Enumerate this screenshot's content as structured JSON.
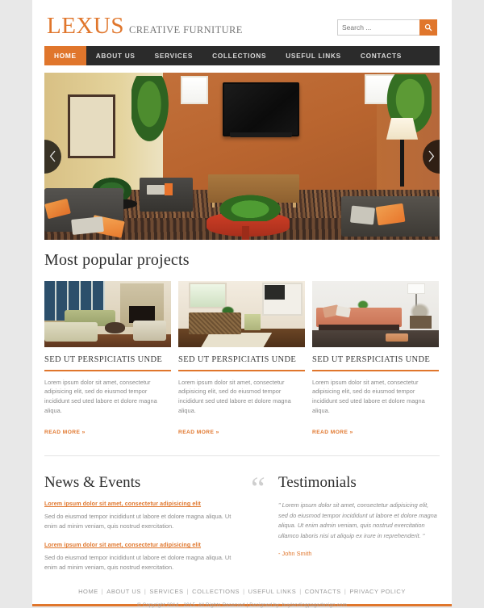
{
  "brand": {
    "name": "LEXUS",
    "tagline": "CREATIVE FURNITURE"
  },
  "search": {
    "placeholder": "Search ...",
    "value": "",
    "button_icon": "search-icon"
  },
  "nav": {
    "items": [
      {
        "label": "HOME",
        "active": true
      },
      {
        "label": "ABOUT US",
        "active": false
      },
      {
        "label": "SERVICES",
        "active": false
      },
      {
        "label": "COLLECTIONS",
        "active": false
      },
      {
        "label": "USEFUL LINKS",
        "active": false
      },
      {
        "label": "CONTACTS",
        "active": false
      }
    ]
  },
  "hero": {
    "prev_icon": "chevron-left-icon",
    "next_icon": "chevron-right-icon",
    "image_alt": "living room with terracotta walls, wall-mounted tv, grey sofas, orange cushions and a red round coffee table"
  },
  "projects": {
    "title": "Most popular projects",
    "cards": [
      {
        "title": "SED UT PERSPICIATIS UNDE",
        "text": "Lorem ipsum dolor sit amet, consectetur adipisicing elit, sed do eiusmod tempor incididunt sed uted labore et dolore magna aliqua.",
        "link": "READ MORE »",
        "image_alt": "living room with stone fireplace and green sofa"
      },
      {
        "title": "SED UT PERSPICIATIS UNDE",
        "text": "Lorem ipsum dolor sit amet, consectetur adipisicing elit, sed do eiusmod tempor incididunt sed uted labore et dolore magna aliqua.",
        "link": "READ MORE »",
        "image_alt": "living room with wicker coffee table and tv wall unit"
      },
      {
        "title": "SED UT PERSPICIATIS UNDE",
        "text": "Lorem ipsum dolor sit amet, consectetur adipisicing elit, sed do eiusmod tempor incididunt sed uted labore et dolore magna aliqua.",
        "link": "READ MORE »",
        "image_alt": "salmon coloured sofa with floor lamp and ottoman"
      }
    ]
  },
  "news": {
    "title": "News & Events",
    "items": [
      {
        "headline": "Lorem ipsum dolor sit amet, consectetur adipisicing elit",
        "body": "Sed do eiusmod tempor incididunt ut labore et dolore magna aliqua. Ut enim ad minim veniam, quis nostrud exercitation."
      },
      {
        "headline": "Lorem ipsum dolor sit amet, consectetur adipisicing elit",
        "body": "Sed do eiusmod tempor incididunt ut labore et dolore magna aliqua. Ut enim ad minim veniam, quis nostrud exercitation."
      }
    ]
  },
  "testimonials": {
    "title": "Testimonials",
    "quote_icon": "quotation-mark-icon",
    "text": "\" Lorem ipsum dolor sit amet, consectetur adipisicing elit, sed do eiusmod tempor incididunt ut labore et dolore magna aliqua. Ut enim admin veniam, quis nostrud exercitation ullamco laboris nisi ut aliquip ex  irure in reprehenderit. \"",
    "author": "- John Smith"
  },
  "footer": {
    "links": [
      "HOME",
      "ABOUT US",
      "SERVICES",
      "COLLECTIONS",
      "USEFUL LINKS",
      "CONTACTS",
      "PRIVACY POLICY"
    ],
    "copyright": "© Copyright 2014 - 2015. All Rights Reserved | Designed by: buylandingpagedesign.com"
  },
  "colors": {
    "accent": "#e0762c",
    "nav_bg": "#2b2b2b",
    "page_bg": "#e8e8e8",
    "container_bg": "#ffffff",
    "body_text": "#8b8b8b"
  }
}
